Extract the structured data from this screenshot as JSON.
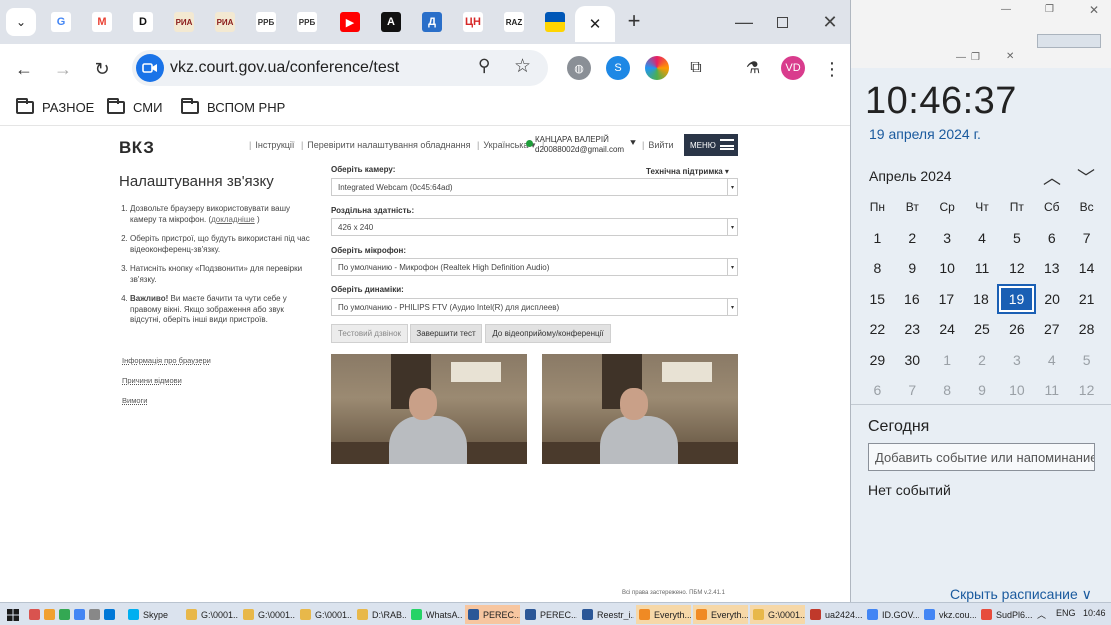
{
  "browser": {
    "tabs": [
      {
        "name": "tab-google",
        "glyph": "G",
        "bg": "#ffffff",
        "fg": "#4285f4"
      },
      {
        "name": "tab-gmail",
        "glyph": "M",
        "bg": "#ffffff",
        "fg": "#ea4335"
      },
      {
        "name": "tab-d",
        "glyph": "D",
        "bg": "#ffffff",
        "fg": "#111111"
      },
      {
        "name": "tab-rma-1",
        "glyph": "РИА",
        "bg": "#f3e9d2",
        "fg": "#8a1a1a"
      },
      {
        "name": "tab-rma-2",
        "glyph": "РИА",
        "bg": "#f3e9d2",
        "fg": "#8a1a1a"
      },
      {
        "name": "tab-rrb-1",
        "glyph": "РРБ",
        "bg": "#ffffff",
        "fg": "#333333"
      },
      {
        "name": "tab-rrb-2",
        "glyph": "РРБ",
        "bg": "#ffffff",
        "fg": "#333333"
      },
      {
        "name": "tab-youtube",
        "glyph": "▶",
        "bg": "#ff0000",
        "fg": "#ffffff"
      },
      {
        "name": "tab-a",
        "glyph": "A",
        "bg": "#111111",
        "fg": "#ffffff"
      },
      {
        "name": "tab-d-blue",
        "glyph": "Д",
        "bg": "#2a6fc9",
        "fg": "#ffffff"
      },
      {
        "name": "tab-cn",
        "glyph": "ЦН",
        "bg": "#ffffff",
        "fg": "#d62828"
      },
      {
        "name": "tab-raz",
        "glyph": "RAZ",
        "bg": "#ffffff",
        "fg": "#222222"
      },
      {
        "name": "tab-ua",
        "glyph": "",
        "bg": "#ffd500",
        "fg": "#0057b7"
      }
    ],
    "url": "vkz.court.gov.ua/conference/test",
    "avatar": "VD",
    "bookmarks": [
      "РАЗНОЕ",
      "СМИ",
      "ВСПОМ РНР"
    ]
  },
  "page": {
    "logo": "ВКЗ",
    "nav": [
      "Інструкції",
      "Перевірити налаштування обладнання",
      "Українська ▾"
    ],
    "user_name": "КАНЦАРА ВАЛЕРІЙ",
    "user_email": "d20088002d@gmail.com",
    "logout": "Вийти",
    "menu": "МЕНЮ",
    "title": "Налаштування зв'язку",
    "steps": {
      "s1": "Дозвольте браузеру використовувати вашу камеру та мікрофон. (",
      "s1_link": "докладніше",
      "s1_end": ")",
      "s2": "Оберіть пристрої, що будуть використані під час відеоконференц-зв'язку.",
      "s3": "Натисніть кнопку «Подзвонити» для перевірки зв'язку.",
      "s4_bold": "Важливо!",
      "s4": " Ви маєте бачити та чути себе у правому вікні. Якщо зображення або звук відсутні, оберіть інші види пристроїв."
    },
    "side_links": [
      "Інформація про браузери",
      "Причини відмови",
      "Вимоги"
    ],
    "support": "Технічна підтримка ▾",
    "fields": {
      "camera_label": "Оберіть камеру:",
      "camera_value": "Integrated Webcam (0c45:64ad)",
      "resolution_label": "Роздільна здатність:",
      "resolution_value": "426 x 240",
      "mic_label": "Оберіть мікрофон:",
      "mic_value": "По умолчанию - Микрофон (Realtek High Definition Audio)",
      "speaker_label": "Оберіть динаміки:",
      "speaker_value": "По умолчанию - PHILIPS FTV (Аудио Intel(R) для дисплеев)"
    },
    "buttons": {
      "test_call": "Тестовий дзвінок",
      "end_test": "Завершити тест",
      "to_room": "До відеоприйому/конференції"
    },
    "footer": "Всі права застережено. ПБМ v.2.41.1"
  },
  "calendar": {
    "time": "10:46:37",
    "date": "19 апреля 2024 г.",
    "month": "Апрель 2024",
    "weekdays": [
      "Пн",
      "Вт",
      "Ср",
      "Чт",
      "Пт",
      "Сб",
      "Вс"
    ],
    "weeks": [
      [
        1,
        2,
        3,
        4,
        5,
        6,
        7
      ],
      [
        8,
        9,
        10,
        11,
        12,
        13,
        14
      ],
      [
        15,
        16,
        17,
        18,
        19,
        20,
        21
      ],
      [
        22,
        23,
        24,
        25,
        26,
        27,
        28
      ],
      [
        29,
        30,
        1,
        2,
        3,
        4,
        5
      ],
      [
        6,
        7,
        8,
        9,
        10,
        11,
        12
      ]
    ],
    "today": 19,
    "today_label": "Сегодня",
    "add_placeholder": "Добавить событие или напоминание",
    "no_events": "Нет событий",
    "hide": "Скрыть расписание ∨"
  },
  "taskbar": {
    "items": [
      {
        "label": "Skype",
        "color": "#00aff0"
      },
      {
        "label": "G:\\0001...",
        "color": "#e8b84a"
      },
      {
        "label": "G:\\0001...",
        "color": "#e8b84a"
      },
      {
        "label": "G:\\0001...",
        "color": "#e8b84a"
      },
      {
        "label": "D:\\RAB...",
        "color": "#e8b84a"
      },
      {
        "label": "WhatsA...",
        "color": "#25d366"
      },
      {
        "label": "PEREC...",
        "color": "#2b5797"
      },
      {
        "label": "PEREC...",
        "color": "#2b5797"
      },
      {
        "label": "Reestr_i...",
        "color": "#2b5797"
      },
      {
        "label": "Everyth...",
        "color": "#f08a24"
      },
      {
        "label": "Everyth...",
        "color": "#f08a24"
      },
      {
        "label": "G:\\0001...",
        "color": "#e8b84a"
      },
      {
        "label": "ua2424...",
        "color": "#c0392b"
      },
      {
        "label": "ID.GOV...",
        "color": "#4285f4"
      },
      {
        "label": "vkz.cou...",
        "color": "#4285f4"
      },
      {
        "label": "SudPl6...",
        "color": "#e74c3c"
      }
    ],
    "lang": "ENG",
    "clock": "10:46"
  }
}
